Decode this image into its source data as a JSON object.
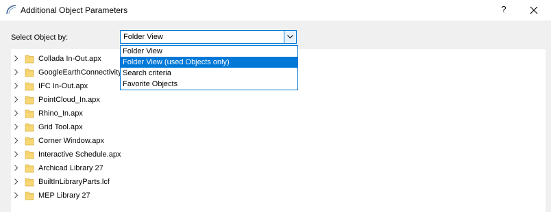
{
  "window": {
    "title": "Additional Object Parameters",
    "help_label": "?"
  },
  "selector": {
    "label": "Select Object by:",
    "value": "Folder View",
    "options": [
      "Folder View",
      "Folder View (used Objects only)",
      "Search criteria",
      "Favorite Objects"
    ],
    "highlighted": "Folder View (used Objects only)"
  },
  "tree": {
    "items": [
      "Collada In-Out.apx",
      "GoogleEarthConnectivity.apx",
      "IFC In-Out.apx",
      "PointCloud_In.apx",
      "Rhino_In.apx",
      "Grid Tool.apx",
      "Corner Window.apx",
      "Interactive Schedule.apx",
      "Archicad Library 27",
      "BuiltInLibraryParts.lcf",
      "MEP Library 27"
    ]
  },
  "colors": {
    "accent": "#0078d7",
    "folder": "#f8d775"
  }
}
